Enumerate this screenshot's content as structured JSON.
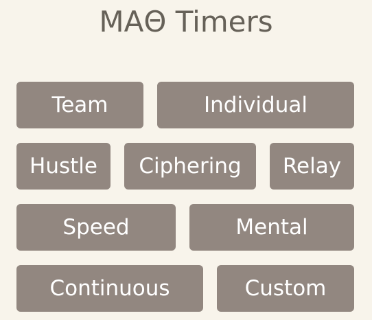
{
  "title": "ΜΑΘ Timers",
  "buttons": {
    "team": "Team",
    "individual": "Individual",
    "hustle": "Hustle",
    "ciphering": "Ciphering",
    "relay": "Relay",
    "speed": "Speed",
    "mental": "Mental",
    "continuous": "Continuous",
    "custom": "Custom"
  },
  "colors": {
    "background": "#f8f4eb",
    "button": "#928780",
    "button_text": "#ffffff",
    "title_text": "#666158"
  }
}
